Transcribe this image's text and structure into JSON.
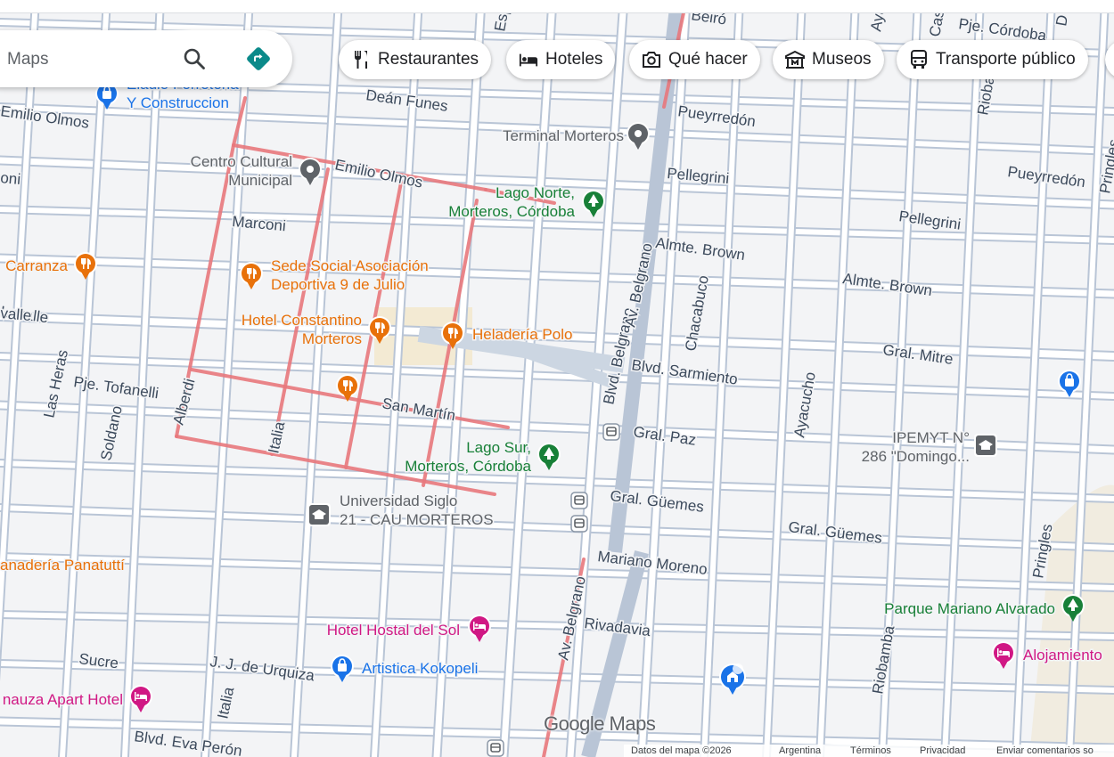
{
  "search": {
    "placeholder": "Maps"
  },
  "chips": [
    {
      "label": "Restaurantes",
      "icon": "fork-knife-icon"
    },
    {
      "label": "Hoteles",
      "icon": "bed-icon"
    },
    {
      "label": "Qué hacer",
      "icon": "camera-icon"
    },
    {
      "label": "Museos",
      "icon": "museum-icon"
    },
    {
      "label": "Transporte público",
      "icon": "bus-icon"
    }
  ],
  "colors": {
    "map_bg": "#f3f4f6",
    "road": "#b9c5d6",
    "route": "#e8787d",
    "park_green": "#188038",
    "food_orange": "#e8710a",
    "hotel_pink": "#d01884",
    "shop_blue": "#1a73e8",
    "street_text": "#3c4a5c",
    "poi_gray": "#5f6368"
  },
  "streets": [
    "Beiró",
    "Pje. Córdoba",
    "Deán Funes",
    "Pueyrredón",
    "Emilio Olmos",
    "Emilio Olmos",
    "Pellegrini",
    "Pueyrredón",
    "Pellegrini",
    "Marconi",
    "Almte. Brown",
    "Almte. Brown",
    "Lavalle",
    "Gral. Mitre",
    "Blvd. Sarmiento",
    "Pje. Tofanelli",
    "San Martín",
    "Gral. Paz",
    "Gral. Güemes",
    "Gral. Güemes",
    "Mariano Moreno",
    "Rivadavia",
    "Sucre",
    "J. J. de Urquiza",
    "Blvd. Eva Perón",
    "Alberdi",
    "Italia",
    "Italia",
    "Las Heras",
    "Soldano",
    "Blvd. Belgrano",
    "Av. Belgrano",
    "Av. Belgrano",
    "Chacabuco",
    "Ayacucho",
    "Riobamba",
    "Riobamba",
    "Pringles",
    "Pringles",
    "Esp",
    "Ayac",
    "Cas",
    "D",
    "oni",
    "valle"
  ],
  "pois": [
    {
      "label": "Eladio Ferreteria",
      "label2": "Y Construccion",
      "category": "shop",
      "icon": "shopping-bag-icon"
    },
    {
      "label": "Terminal Morteros",
      "category": "transit",
      "icon": "location-pin-icon"
    },
    {
      "label": "Centro Cultural",
      "label2": "Municipal",
      "category": "landmark",
      "icon": "location-pin-icon"
    },
    {
      "label": "Lago Norte,",
      "label2": "Morteros, Córdoba",
      "category": "park",
      "icon": "tree-icon"
    },
    {
      "label": "Carranza",
      "category": "food",
      "icon": "fork-knife-icon"
    },
    {
      "label": "Sede Social Asociación",
      "label2": "Deportiva 9 de Julio",
      "category": "food",
      "icon": "fork-knife-icon"
    },
    {
      "label": "Hotel Constantino",
      "label2": "Morteros",
      "category": "food",
      "icon": "fork-knife-icon"
    },
    {
      "label": "Heladería Polo",
      "category": "food",
      "icon": "fork-knife-icon"
    },
    {
      "label": "Lago Sur,",
      "label2": "Morteros, Córdoba",
      "category": "park",
      "icon": "tree-icon"
    },
    {
      "label": "IPEMYT N°",
      "label2": "286 \"Domingo...",
      "category": "school",
      "icon": "graduation-cap-icon"
    },
    {
      "label": "Universidad Siglo",
      "label2": "21 - CAU MORTEROS",
      "category": "school",
      "icon": "graduation-cap-icon"
    },
    {
      "label": "anadería Panatuttí",
      "category": "food",
      "icon": ""
    },
    {
      "label": "Parque Mariano Alvarado",
      "category": "park",
      "icon": "tree-icon"
    },
    {
      "label": "Hotel Hostal del Sol",
      "category": "hotel",
      "icon": "bed-icon"
    },
    {
      "label": "Artistica Kokopeli",
      "category": "shop",
      "icon": "shopping-bag-icon"
    },
    {
      "label": "Alojamiento",
      "category": "hotel",
      "icon": "bed-icon"
    },
    {
      "label": "nauza Apart Hotel",
      "category": "hotel",
      "icon": "bed-icon"
    },
    {
      "label": "",
      "category": "food",
      "icon": "fork-knife-icon"
    },
    {
      "label": "",
      "category": "shop",
      "icon": "shopping-bag-icon"
    },
    {
      "label": "",
      "category": "transit",
      "icon": "bus-icon"
    },
    {
      "label": "",
      "category": "transit",
      "icon": "bus-icon"
    },
    {
      "label": "",
      "category": "transit",
      "icon": "bus-icon"
    },
    {
      "label": "",
      "category": "transit",
      "icon": "bus-icon"
    },
    {
      "label": "",
      "category": "place",
      "icon": "home-pin-icon"
    }
  ],
  "logo": {
    "text": "Google Maps"
  },
  "footer": {
    "items": [
      "Datos del mapa ©2026",
      "Argentina",
      "Términos",
      "Privacidad",
      "Enviar comentarios so"
    ]
  }
}
